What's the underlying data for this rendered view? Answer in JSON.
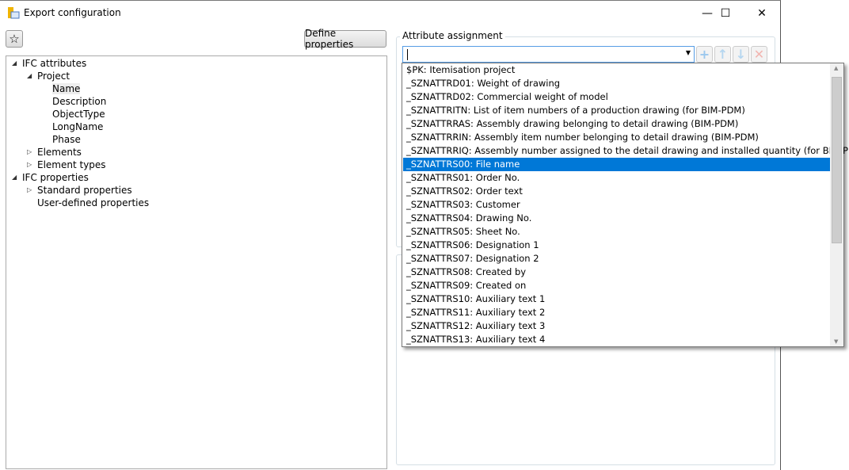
{
  "window": {
    "title": "Export configuration",
    "minimize": "—",
    "maximize": "☐",
    "close": "✕"
  },
  "toolbar": {
    "favorite_icon": "star-icon",
    "define_properties": "Define properties"
  },
  "tree": [
    {
      "label": "IFC attributes",
      "level": 0,
      "expanded": true
    },
    {
      "label": "Project",
      "level": 1,
      "expanded": true
    },
    {
      "label": "Name",
      "level": 2,
      "selected": true
    },
    {
      "label": "Description",
      "level": 2
    },
    {
      "label": "ObjectType",
      "level": 2
    },
    {
      "label": "LongName",
      "level": 2
    },
    {
      "label": "Phase",
      "level": 2
    },
    {
      "label": "Elements",
      "level": 1,
      "expanded": false
    },
    {
      "label": "Element types",
      "level": 1,
      "expanded": false
    },
    {
      "label": "IFC properties",
      "level": 0,
      "expanded": true
    },
    {
      "label": "Standard properties",
      "level": 1,
      "expanded": false
    },
    {
      "label": "User-defined properties",
      "level": 1
    }
  ],
  "attribute_assignment": {
    "label": "Attribute assignment",
    "combo_value": "",
    "buttons": [
      "plus-icon",
      "arrow-up-icon",
      "arrow-down-icon",
      "delete-icon"
    ],
    "options": [
      "$PK: Itemisation project",
      "_SZNATTRD01: Weight of drawing",
      "_SZNATTRD02: Commercial weight of model",
      "_SZNATTRITN: List of item numbers of a production drawing (for BIM-PDM)",
      "_SZNATTRRAS: Assembly drawing belonging to detail drawing (BIM-PDM)",
      "_SZNATTRRIN: Assembly item number belonging to detail drawing (BIM-PDM)",
      "_SZNATTRRIQ: Assembly number assigned to the detail drawing and installed quantity (for BIM-PDM)",
      "_SZNATTRS00: File name",
      "_SZNATTRS01: Order No.",
      "_SZNATTRS02: Order text",
      "_SZNATTRS03: Customer",
      "_SZNATTRS04: Drawing No.",
      "_SZNATTRS05: Sheet No.",
      "_SZNATTRS06: Designation 1",
      "_SZNATTRS07: Designation 2",
      "_SZNATTRS08: Created by",
      "_SZNATTRS09: Created on",
      "_SZNATTRS10: Auxiliary text 1",
      "_SZNATTRS11: Auxiliary text 2",
      "_SZNATTRS12: Auxiliary text 3",
      "_SZNATTRS13: Auxiliary text 4"
    ],
    "selected_index": 7
  },
  "colors": {
    "selection": "#0078d7"
  }
}
